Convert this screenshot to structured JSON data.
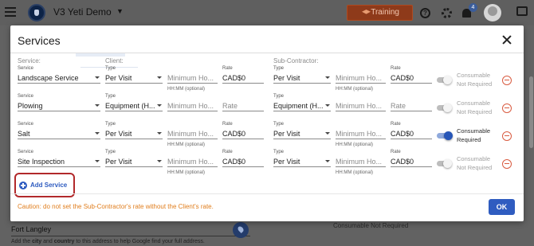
{
  "app": {
    "title": "V3 Yeti Demo",
    "training_label": "Training",
    "notification_count": "4",
    "colors": {
      "topbar": "#5f5f5f",
      "training": "#8e3a1a",
      "accent": "#2f5cc0",
      "remove": "#d95b40",
      "caution": "#e07d1c"
    }
  },
  "background": {
    "location_value": "Fort Langley",
    "hint_parts": [
      "Add the ",
      "city",
      " and ",
      "country",
      " to this address to help Google find your full address."
    ],
    "consumable_text": "Consumable Not Required"
  },
  "modal": {
    "title": "Services",
    "section_service": "Service:",
    "section_client": "Client:",
    "section_subcontractor": "Sub-Contractor:",
    "field_labels": {
      "service": "Service",
      "type": "Type",
      "rate": "Rate"
    },
    "min_hours_placeholder": "Minimum Ho...",
    "rate_placeholder": "Rate",
    "hhmm_help": "HH:MM (optional)",
    "rows": [
      {
        "service": "Landscape Service",
        "client_type": "Per Visit",
        "client_rate": "CAD$0",
        "sub_type": "Per Visit",
        "sub_rate": "CAD$0",
        "consumable_on": false,
        "consumable_line1": "Consumable",
        "consumable_line2": "Not Required"
      },
      {
        "service": "Plowing",
        "client_type": "Equipment (H...",
        "client_rate": "",
        "sub_type": "Equipment (H...",
        "sub_rate": "",
        "consumable_on": false,
        "consumable_line1": "Consumable",
        "consumable_line2": "Not Required"
      },
      {
        "service": "Salt",
        "client_type": "Per Visit",
        "client_rate": "CAD$0",
        "sub_type": "Per Visit",
        "sub_rate": "CAD$0",
        "consumable_on": true,
        "consumable_line1": "Consumable",
        "consumable_line2": "Required"
      },
      {
        "service": "Site Inspection",
        "client_type": "Per Visit",
        "client_rate": "CAD$0",
        "sub_type": "Per Visit",
        "sub_rate": "CAD$0",
        "consumable_on": false,
        "consumable_line1": "Consumable",
        "consumable_line2": "Not Required"
      }
    ],
    "add_service_label": "Add Service",
    "caution_text": "Caution: do not set the Sub-Contractor's rate without the Client's rate.",
    "ok_label": "OK"
  }
}
